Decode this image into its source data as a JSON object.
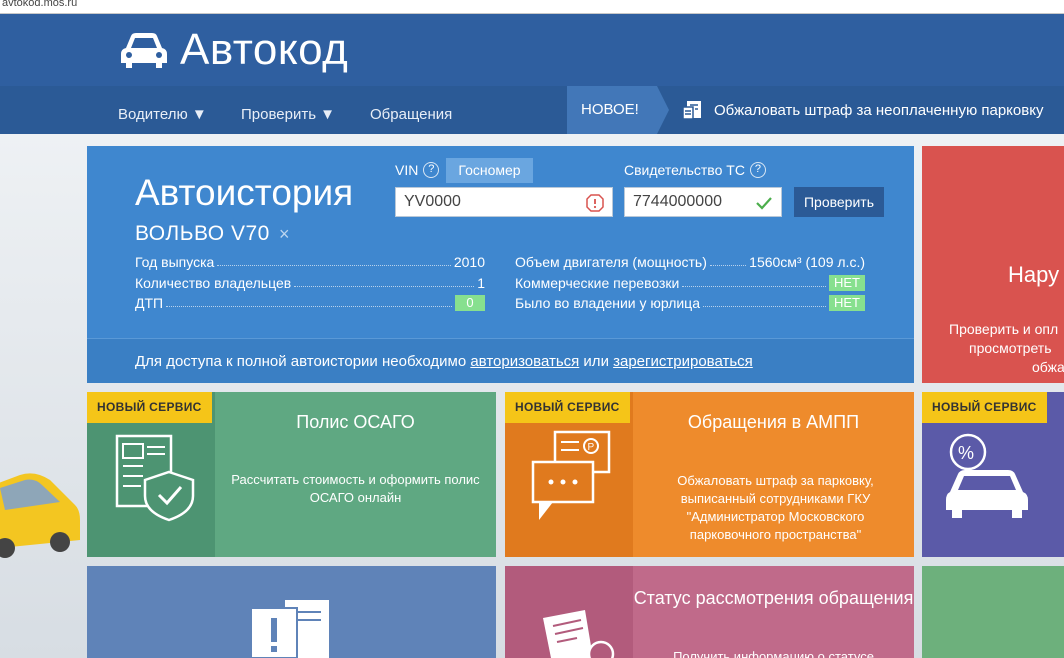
{
  "browser": {
    "url": "avtokod.mos.ru"
  },
  "header": {
    "logo_text": "Автокод"
  },
  "nav": {
    "items": [
      {
        "label": "Водителю ▼"
      },
      {
        "label": "Проверить ▼"
      },
      {
        "label": "Обращения"
      }
    ],
    "new_tag": "НОВОЕ!",
    "promo_link": "Обжаловать штраф за неоплаченную парковку"
  },
  "autohistory": {
    "title": "Автоистория",
    "model": "ВОЛЬВО V70",
    "close_glyph": "×",
    "vin_label": "VIN",
    "gosnomer_tab": "Госномер",
    "cert_label": "Свидетельство ТС",
    "vin_value": "YV0000",
    "cert_value": "7744000000",
    "check_button": "Проверить",
    "left_rows": [
      {
        "key": "Год выпуска",
        "value": "2010"
      },
      {
        "key": "Количество владельцев",
        "value": "1"
      },
      {
        "key": "ДТП",
        "value": "0"
      }
    ],
    "right_rows": [
      {
        "key": "Объем двигателя (мощность)",
        "value": "1560см³ (109 л.с.)"
      },
      {
        "key": "Коммерческие перевозки",
        "value": "НЕТ"
      },
      {
        "key": "Было во владении у юрлица",
        "value": "НЕТ"
      }
    ],
    "footer_text_1": "Для доступа к полной автоистории необходимо ",
    "footer_link_1": "авторизоваться",
    "footer_text_2": " или ",
    "footer_link_2": "зарегистрироваться"
  },
  "side_card": {
    "title": "Нару",
    "desc_line1": "Проверить и опл",
    "desc_line2": "просмотреть",
    "desc_line3": "обжа"
  },
  "tiles": [
    {
      "badge": "НОВЫЙ СЕРВИС",
      "title": "Полис ОСАГО",
      "desc": "Рассчитать стоимость и оформить полис ОСАГО онлайн"
    },
    {
      "badge": "НОВЫЙ СЕРВИС",
      "title": "Обращения в АМПП",
      "desc": "Обжаловать штраф за парковку, выписанный сотрудниками ГКУ \"Администратор Московского парковочного пространства\""
    },
    {
      "badge": "НОВЫЙ СЕРВИС"
    },
    {
      "title": "Статус рассмотрения обращения",
      "desc": "Получить информацию о статусе"
    }
  ],
  "colors": {
    "header": "#2f5fa0",
    "autohistory_bg": "#3f87cf",
    "osago": "#5fa882",
    "ampp": "#ee8b2c",
    "purple": "#5b5aa8",
    "status": "#c06a8a",
    "red": "#d9534f",
    "badge_yellow": "#f5c518"
  }
}
